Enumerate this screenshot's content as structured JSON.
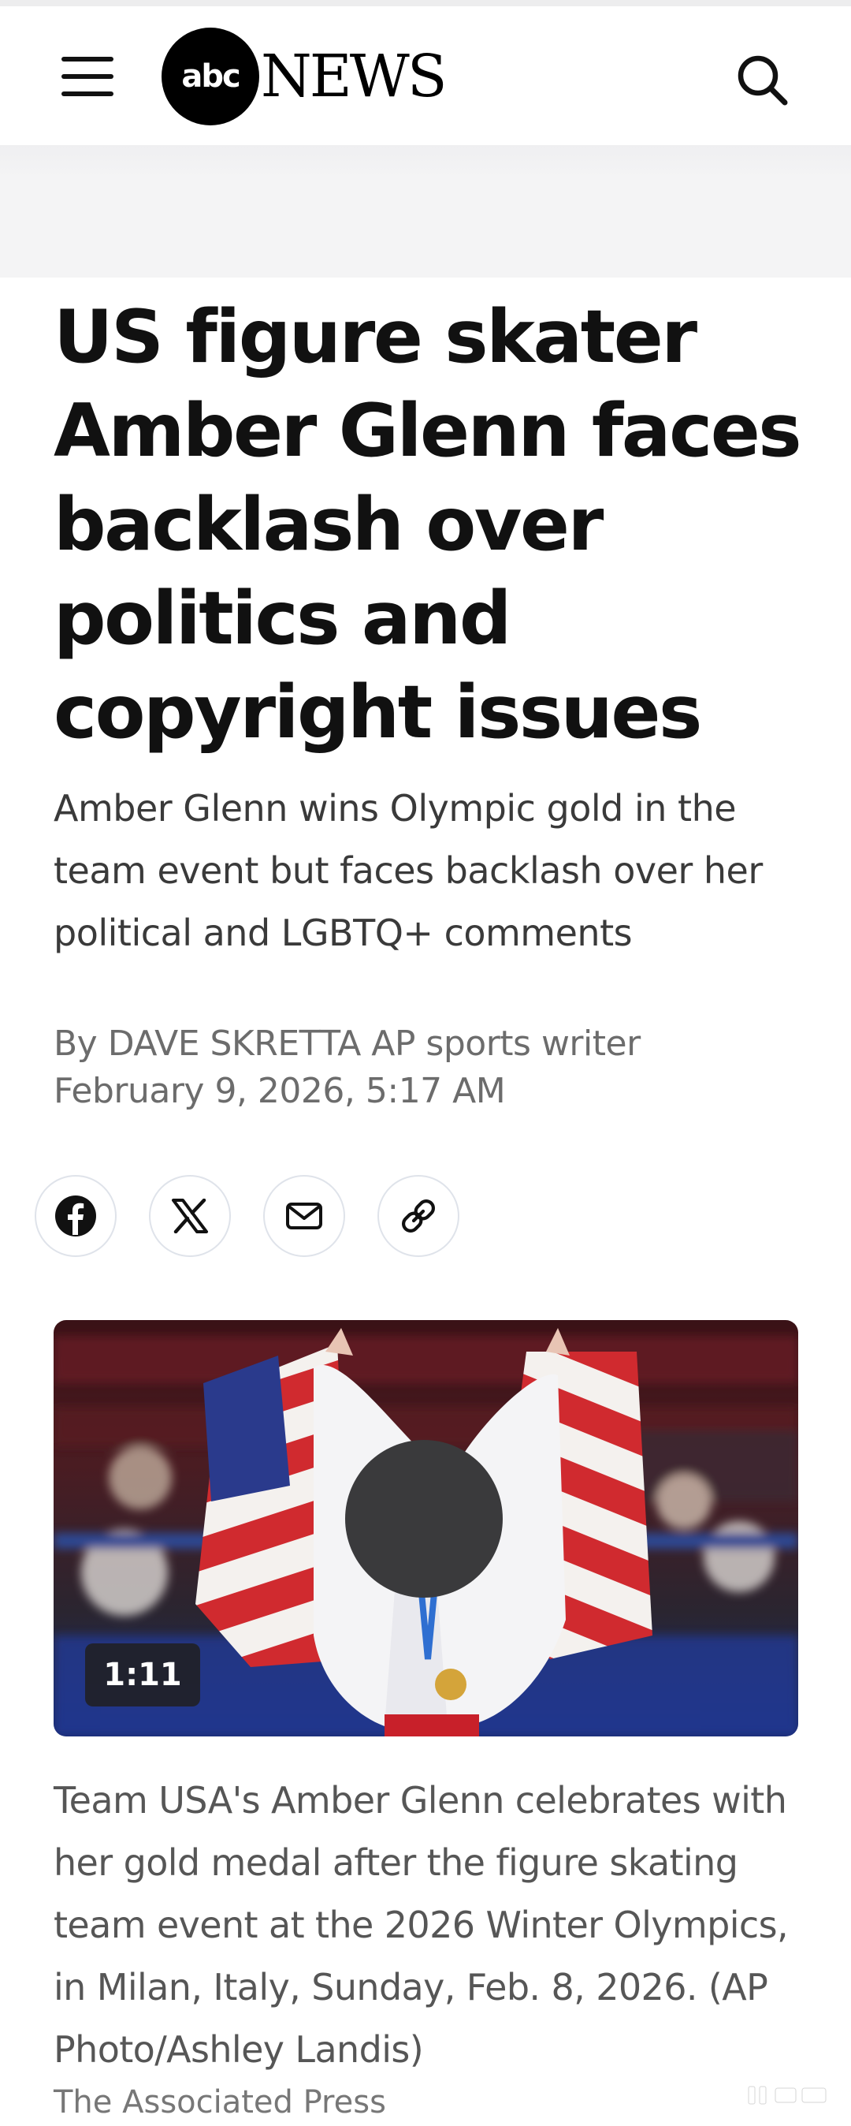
{
  "app": {
    "brand": "abcNEWS",
    "logo_circle_text": "abc",
    "logo_word_text": "NEWS"
  },
  "header": {
    "menu_icon": "hamburger-menu-icon",
    "search_icon": "search-icon"
  },
  "article": {
    "headline": "US figure skater Amber Glenn faces backlash over politics and copyright issues",
    "subheadline": "Amber Glenn wins Olympic gold in the team event but faces backlash over her political and LGBTQ+ comments",
    "byline": "By DAVE SKRETTA AP sports writer",
    "date": "February 9, 2026, 5:17 AM",
    "share_buttons": [
      {
        "name": "facebook",
        "icon": "facebook-icon"
      },
      {
        "name": "x",
        "icon": "x-icon"
      },
      {
        "name": "email",
        "icon": "mail-icon"
      },
      {
        "name": "copy-link",
        "icon": "link-icon"
      }
    ],
    "video": {
      "duration": "1:11"
    },
    "caption": "Team USA's Amber Glenn celebrates with her gold medal after the figure skating team event at the 2026 Winter Olympics, in Milan, Italy, Sunday, Feb. 8, 2026. (AP Photo/Ashley Landis)",
    "credit": "The Associated Press"
  },
  "colors": {
    "text_primary": "#111111",
    "text_secondary": "#3a3a3a",
    "text_muted": "#6c6c6c",
    "ad_background": "#f4f4f5",
    "share_border": "#dfe3ea"
  }
}
